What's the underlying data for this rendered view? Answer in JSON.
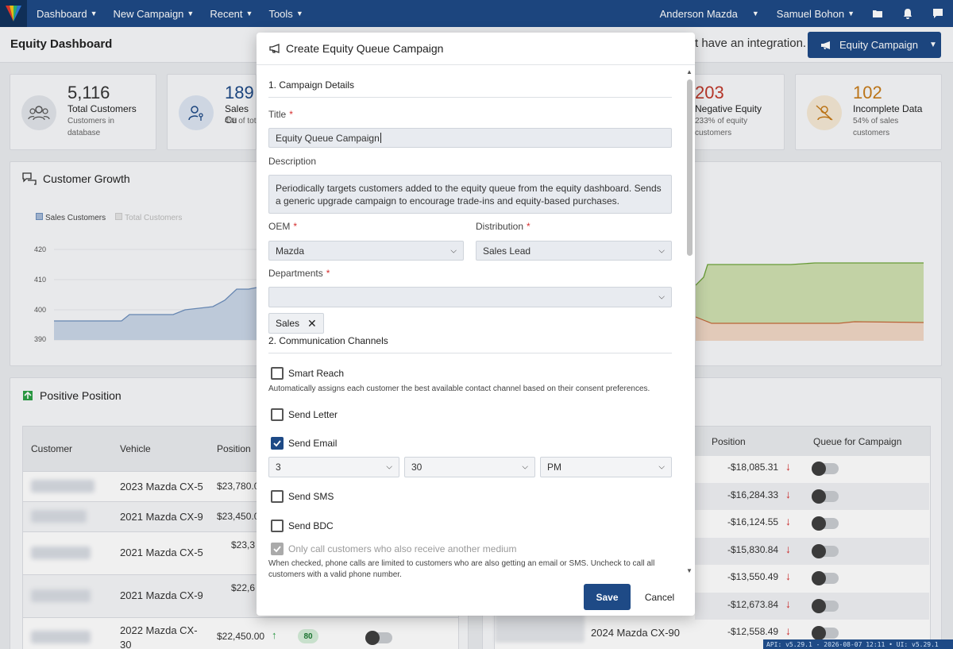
{
  "nav": {
    "items": [
      "Dashboard",
      "New Campaign",
      "Recent",
      "Tools"
    ],
    "user_dealer": "Anderson Mazda",
    "user_name": "Samuel Bohon"
  },
  "page": {
    "title": "Equity Dashboard",
    "integration_text": "t have an integration.",
    "equity_button": "Equity Campaign"
  },
  "stats": [
    {
      "number": "5,116",
      "label": "Total Customers",
      "sub": "Customers in database",
      "color": "#333333"
    },
    {
      "number": "189",
      "label": "Sales Cu",
      "sub": "4% of tot customers",
      "color": "#1e4a86"
    },
    {
      "number": "203",
      "label": "Negative Equity",
      "sub": "233% of equity customers",
      "color": "#c0392b"
    },
    {
      "number": "102",
      "label": "Incomplete Data",
      "sub": "54% of sales customers",
      "color": "#c77c1a"
    }
  ],
  "growth": {
    "title": "Customer Growth",
    "legend": [
      "Sales Customers",
      "Total Customers"
    ],
    "yticks": [
      "420",
      "410",
      "400",
      "390"
    ]
  },
  "positive": {
    "title": "Positive Position",
    "columns": [
      "Customer",
      "Vehicle",
      "Position"
    ],
    "rows": [
      {
        "vehicle": "2023 Mazda CX-5",
        "position": "$23,780.0"
      },
      {
        "vehicle": "2021 Mazda CX-9",
        "position": "$23,450.0"
      },
      {
        "vehicle": "2021 Mazda CX-5",
        "position": "$23,3"
      },
      {
        "vehicle": "2021 Mazda CX-9",
        "position": "$22,6"
      },
      {
        "vehicle": "2022 Mazda CX-30",
        "position": "$22,450.00",
        "score": "80"
      }
    ]
  },
  "negative": {
    "columns": [
      "Position",
      "Queue for Campaign"
    ],
    "rows": [
      "-$18,085.31",
      "-$16,284.33",
      "-$16,124.55",
      "-$15,830.84",
      "-$13,550.49",
      "-$12,673.84",
      "-$12,558.49"
    ],
    "last_vehicle": "2024 Mazda CX-90"
  },
  "modal": {
    "title": "Create Equity Queue Campaign",
    "section1": "1. Campaign Details",
    "title_label": "Title",
    "title_value": "Equity Queue Campaign",
    "description_label": "Description",
    "description_value": "Periodically targets customers added to the equity queue from the equity dashboard. Sends a generic upgrade campaign to encourage trade-ins and equity-based purchases.",
    "oem_label": "OEM",
    "oem_value": "Mazda",
    "distribution_label": "Distribution",
    "distribution_value": "Sales Lead",
    "departments_label": "Departments",
    "department_tag": "Sales",
    "section2": "2. Communication Channels",
    "smart_reach": "Smart Reach",
    "smart_reach_help": "Automatically assigns each customer the best available contact channel based on their consent preferences.",
    "send_letter": "Send Letter",
    "send_email": "Send Email",
    "email_hour": "3",
    "email_minute": "30",
    "email_ampm": "PM",
    "send_sms": "Send SMS",
    "send_bdc": "Send BDC",
    "only_call": "Only call customers who also receive another medium",
    "only_call_help": "When checked, phone calls are limited to customers who are also getting an email or SMS. Uncheck to call all customers with a valid phone number.",
    "save": "Save",
    "cancel": "Cancel"
  },
  "footer": "API: v5.29.1 - 2026-08-07 12:11 • UI: v5.29.1"
}
